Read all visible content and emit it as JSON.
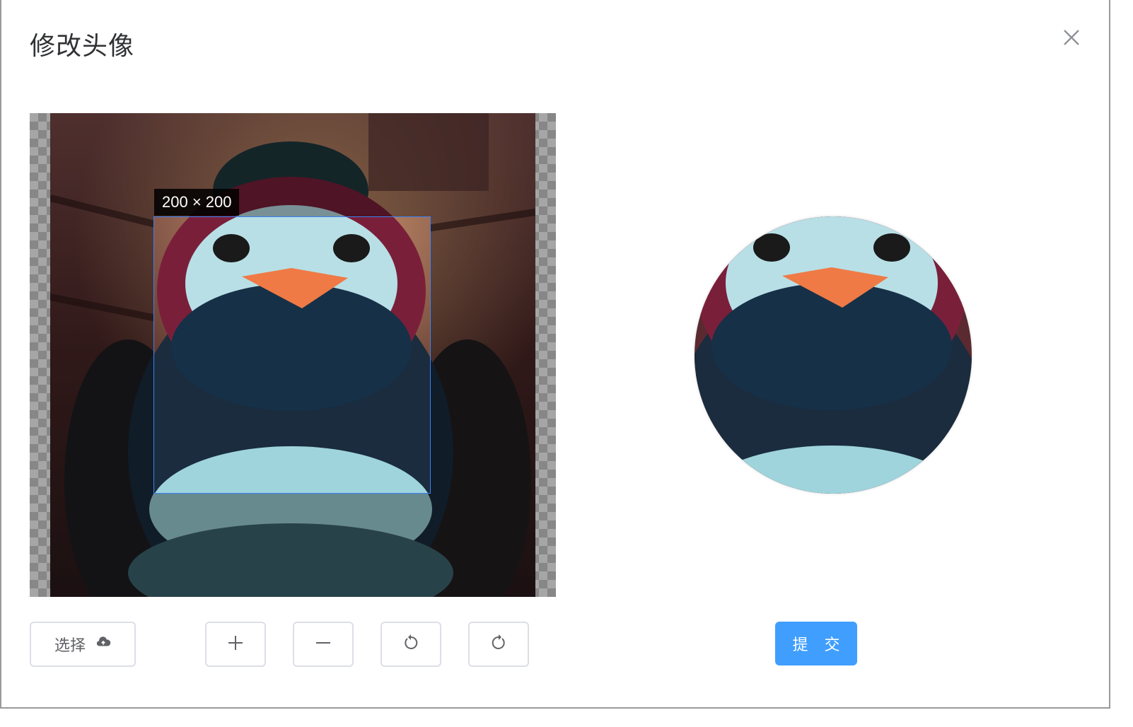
{
  "dialog": {
    "title": "修改头像",
    "close_icon": "close-icon"
  },
  "cropper": {
    "size_label": "200 × 200",
    "image_description_icon": "bird-avatar-image"
  },
  "toolbar": {
    "select_label": "选择",
    "select_icon": "upload-cloud-icon",
    "zoom_in_icon": "plus-icon",
    "zoom_out_icon": "minus-icon",
    "rotate_left_icon": "rotate-left-icon",
    "rotate_right_icon": "rotate-right-icon",
    "submit_label": "提 交"
  },
  "colors": {
    "primary": "#409eff",
    "crop_border": "#3b82f6"
  }
}
